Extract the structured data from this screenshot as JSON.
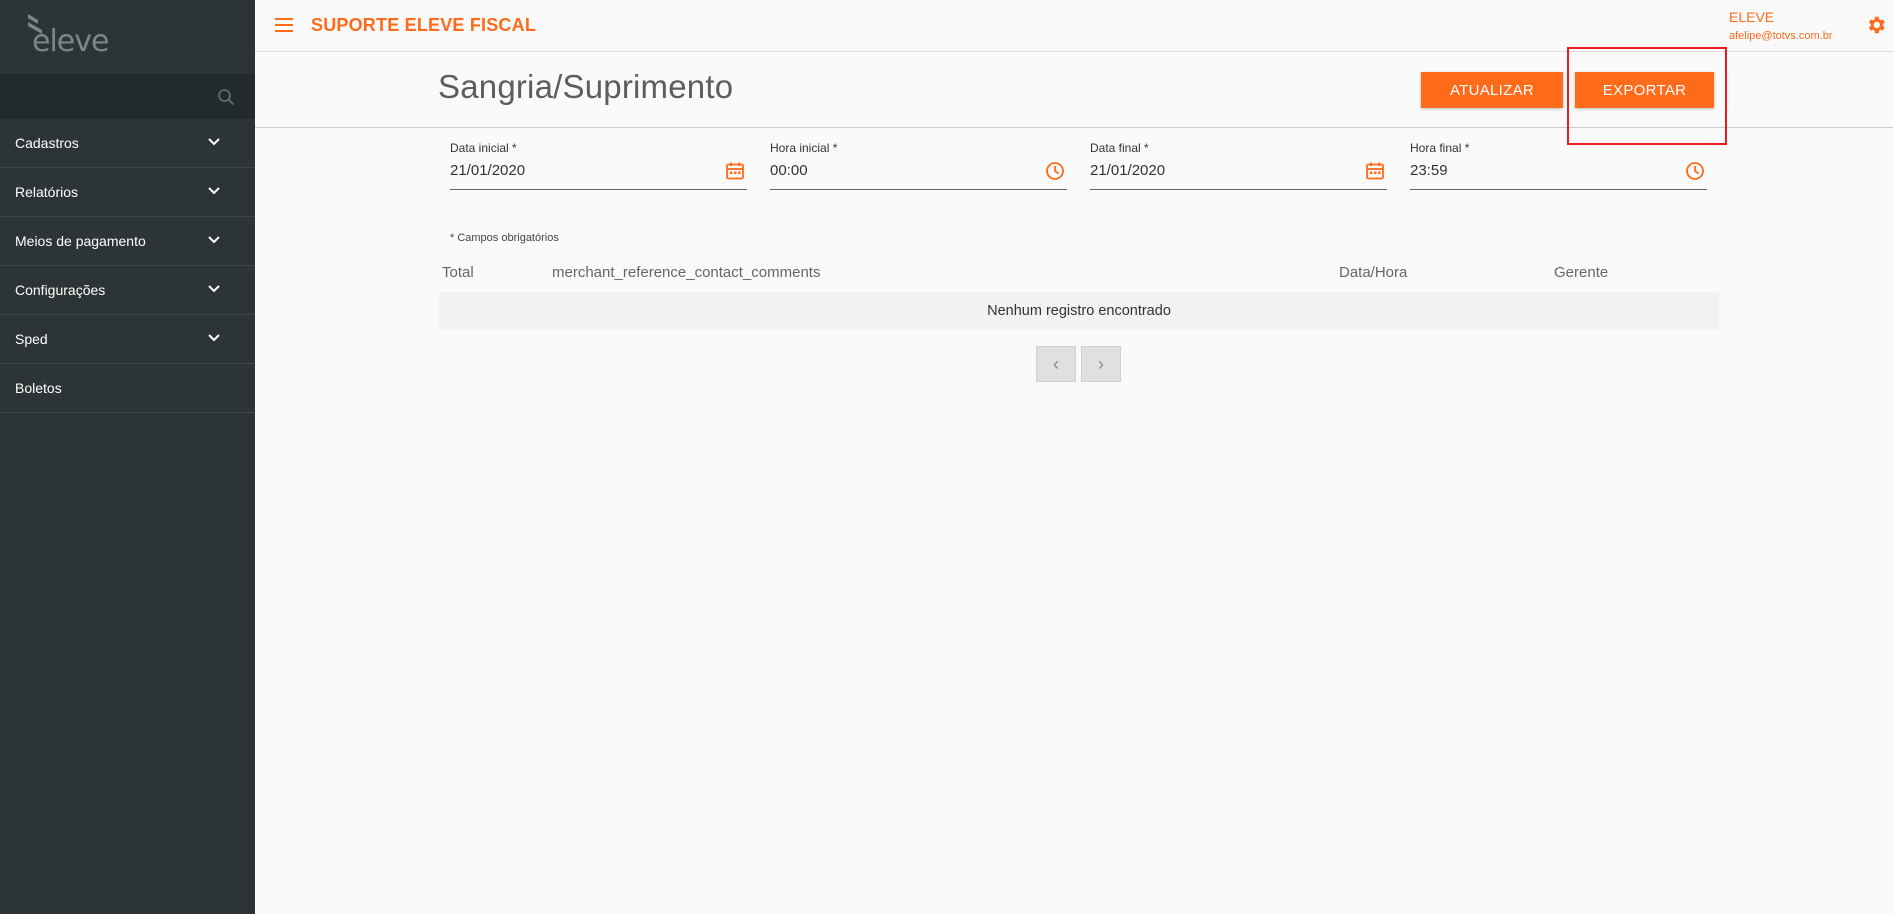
{
  "sidebar": {
    "logo_text": "eleve",
    "search": {
      "placeholder": "",
      "value": ""
    },
    "items": [
      {
        "label": "Cadastros",
        "expandable": true
      },
      {
        "label": "Relatórios",
        "expandable": true
      },
      {
        "label": "Meios de pagamento",
        "expandable": true
      },
      {
        "label": "Configurações",
        "expandable": true
      },
      {
        "label": "Sped",
        "expandable": true
      },
      {
        "label": "Boletos",
        "expandable": false
      }
    ]
  },
  "header": {
    "title": "SUPORTE ELEVE FISCAL",
    "user_name": "ELEVE",
    "user_email": "afelipe@totvs.com.br"
  },
  "page": {
    "title": "Sangria/Suprimento",
    "buttons": {
      "atualizar": "ATUALIZAR",
      "exportar": "EXPORTAR"
    }
  },
  "filters": {
    "data_inicial": {
      "label": "Data inicial *",
      "value": "21/01/2020"
    },
    "hora_inicial": {
      "label": "Hora inicial *",
      "value": "00:00"
    },
    "data_final": {
      "label": "Data final *",
      "value": "21/01/2020"
    },
    "hora_final": {
      "label": "Hora final *",
      "value": "23:59"
    },
    "required_note": "* Campos obrigatórios"
  },
  "table": {
    "columns": [
      "Total",
      "merchant_reference_contact_comments",
      "Data/Hora",
      "Gerente"
    ],
    "empty_message": "Nenhum registro encontrado"
  },
  "pagination": {
    "prev": "‹",
    "next": "›"
  },
  "colors": {
    "accent": "#ff6b1a",
    "sidebar_bg": "#2c3436",
    "highlight": "#ee1b1b"
  }
}
